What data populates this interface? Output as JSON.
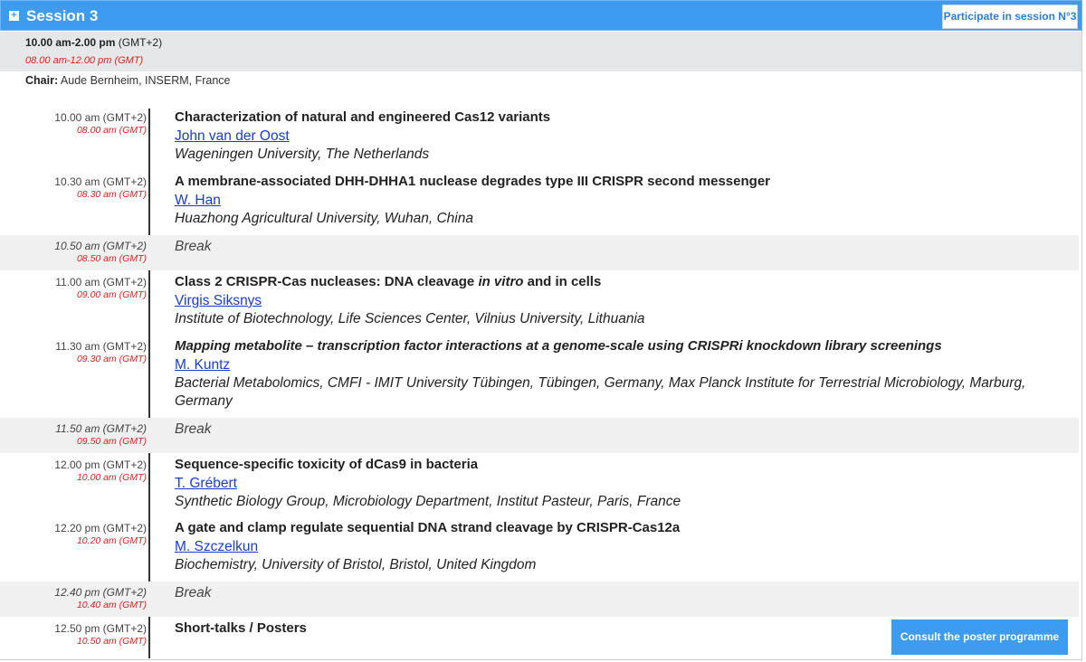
{
  "header": {
    "title": "Session 3",
    "participate_label": "Participate in session N°3"
  },
  "session": {
    "time_main": "10.00 am-2.00 pm",
    "time_main_zone": "(GMT+2)",
    "time_gmt": "08.00 am-12.00 pm (GMT)",
    "chair_label": "Chair:",
    "chair_name": "Aude Bernheim, INSERM, France"
  },
  "rows": [
    {
      "time": "10.00 am (GMT+2)",
      "gmt": "08.00 am (GMT)",
      "title": "Characterization of natural and engineered Cas12 variants",
      "speaker": "John van der Oost",
      "affiliation": "Wageningen University, The Netherlands"
    },
    {
      "time": "10.30 am (GMT+2)",
      "gmt": "08.30 am (GMT)",
      "title": "A membrane-associated DHH-DHHA1 nuclease degrades type III CRISPR second messenger",
      "speaker": "W. Han",
      "affiliation": "Huazhong Agricultural University, Wuhan, China"
    },
    {
      "time": "10.50 am (GMT+2)",
      "gmt": "08.50 am (GMT)",
      "label": "Break"
    },
    {
      "time": "11.00 am (GMT+2)",
      "gmt": "09.00 am (GMT)",
      "title_pre": "Class 2 CRISPR-Cas nucleases: DNA cleavage ",
      "title_em": "in vitro",
      "title_post": " and in cells",
      "speaker": "Virgis Siksnys",
      "affiliation": "Institute of Biotechnology, Life Sciences Center, Vilnius University, Lithuania"
    },
    {
      "time": "11.30 am (GMT+2)",
      "gmt": "09.30 am (GMT)",
      "title": "Mapping metabolite – transcription factor interactions at a genome-scale using CRISPRi knockdown library screenings",
      "speaker": "M. Kuntz",
      "affiliation": "Bacterial Metabolomics, CMFI - IMIT University Tübingen, Tübingen, Germany, Max Planck Institute for Terrestrial Microbiology, Marburg, Germany"
    },
    {
      "time": "11.50 am (GMT+2)",
      "gmt": "09.50 am (GMT)",
      "label": "Break"
    },
    {
      "time": "12.00 pm (GMT+2)",
      "gmt": "10.00 am (GMT)",
      "title": "Sequence-specific toxicity of dCas9 in bacteria",
      "speaker": "T. Grébert",
      "affiliation": "Synthetic Biology Group, Microbiology Department, Institut Pasteur, Paris, France"
    },
    {
      "time": "12.20 pm (GMT+2)",
      "gmt": "10.20 am (GMT)",
      "title": "A gate and clamp regulate sequential DNA strand cleavage by CRISPR-Cas12a",
      "speaker": "M. Szczelkun",
      "affiliation": "Biochemistry, University of Bristol, Bristol, United Kingdom"
    },
    {
      "time": "12.40 pm (GMT+2)",
      "gmt": "10.40 am (GMT)",
      "label": "Break"
    },
    {
      "time": "12.50 pm (GMT+2)",
      "gmt": "10.50 am (GMT)",
      "title": "Short-talks / Posters"
    }
  ],
  "poster_button": "Consult the poster programme",
  "colors": {
    "accent": "#3d9bf0",
    "gmt_red": "#e02020",
    "link": "#1a3bd6"
  },
  "icons": {
    "expand": "plus-square-icon"
  }
}
